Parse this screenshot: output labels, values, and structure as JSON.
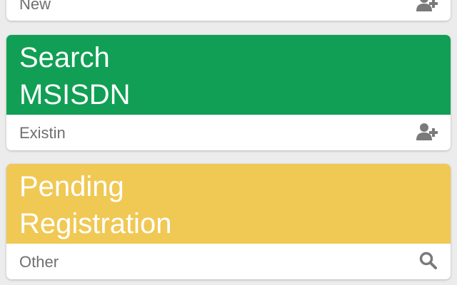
{
  "cards": [
    {
      "footer_label": "New",
      "footer_icon": "add-user-icon"
    },
    {
      "title": "Search\nMSISDN",
      "color": "#119f55",
      "footer_label": "Existin",
      "footer_icon": "add-user-icon"
    },
    {
      "title": "Pending\nRegistration",
      "color": "#f0c854",
      "footer_label": "Other",
      "footer_icon": "search-icon"
    }
  ]
}
